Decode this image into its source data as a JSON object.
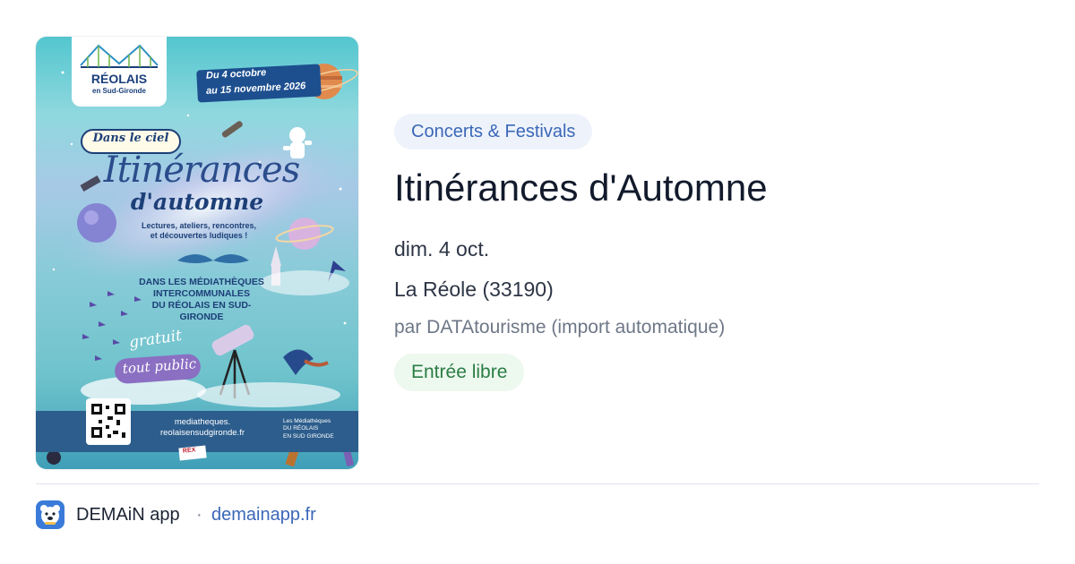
{
  "poster": {
    "logo_title": "RÉOLAIS",
    "logo_subtitle": "en Sud-Gironde",
    "date_line_1": "Du 4 octobre",
    "date_line_2": "au 15 novembre 2026",
    "banner": "Dans le ciel",
    "title": "Itinérances",
    "subtitle": "d'automne",
    "tagline_1": "Lectures, ateliers, rencontres,",
    "tagline_2": "et découvertes ludiques !",
    "venue_1": "DANS LES MÉDIATHÈQUES",
    "venue_2": "INTERCOMMUNALES",
    "venue_3": "DU RÉOLAIS EN SUD-GIRONDE",
    "gratuit": "gratuit",
    "tout_public": "tout public",
    "site_1": "mediatheques.",
    "site_2": "reolaisensudgironde.fr",
    "les_med_1": "Les Médiathèques",
    "les_med_2": "DU RÉOLAIS",
    "les_med_3": "EN SUD GIRONDE",
    "rex": "REX"
  },
  "event": {
    "category": "Concerts & Festivals",
    "title": "Itinérances d'Automne",
    "date": "dim. 4 oct.",
    "location": "La Réole (33190)",
    "source": "par DATAtourisme (import automatique)",
    "price": "Entrée libre"
  },
  "footer": {
    "app_name": "DEMAiN app",
    "separator": "·",
    "domain": "demainapp.fr"
  },
  "colors": {
    "category_badge_bg": "#eef3fb",
    "category_badge_text": "#3b67b8",
    "price_badge_bg": "#edf8ef",
    "price_badge_text": "#2a7d43",
    "link": "#3b67b8"
  },
  "icons": {
    "app": "demain-bear-icon"
  }
}
